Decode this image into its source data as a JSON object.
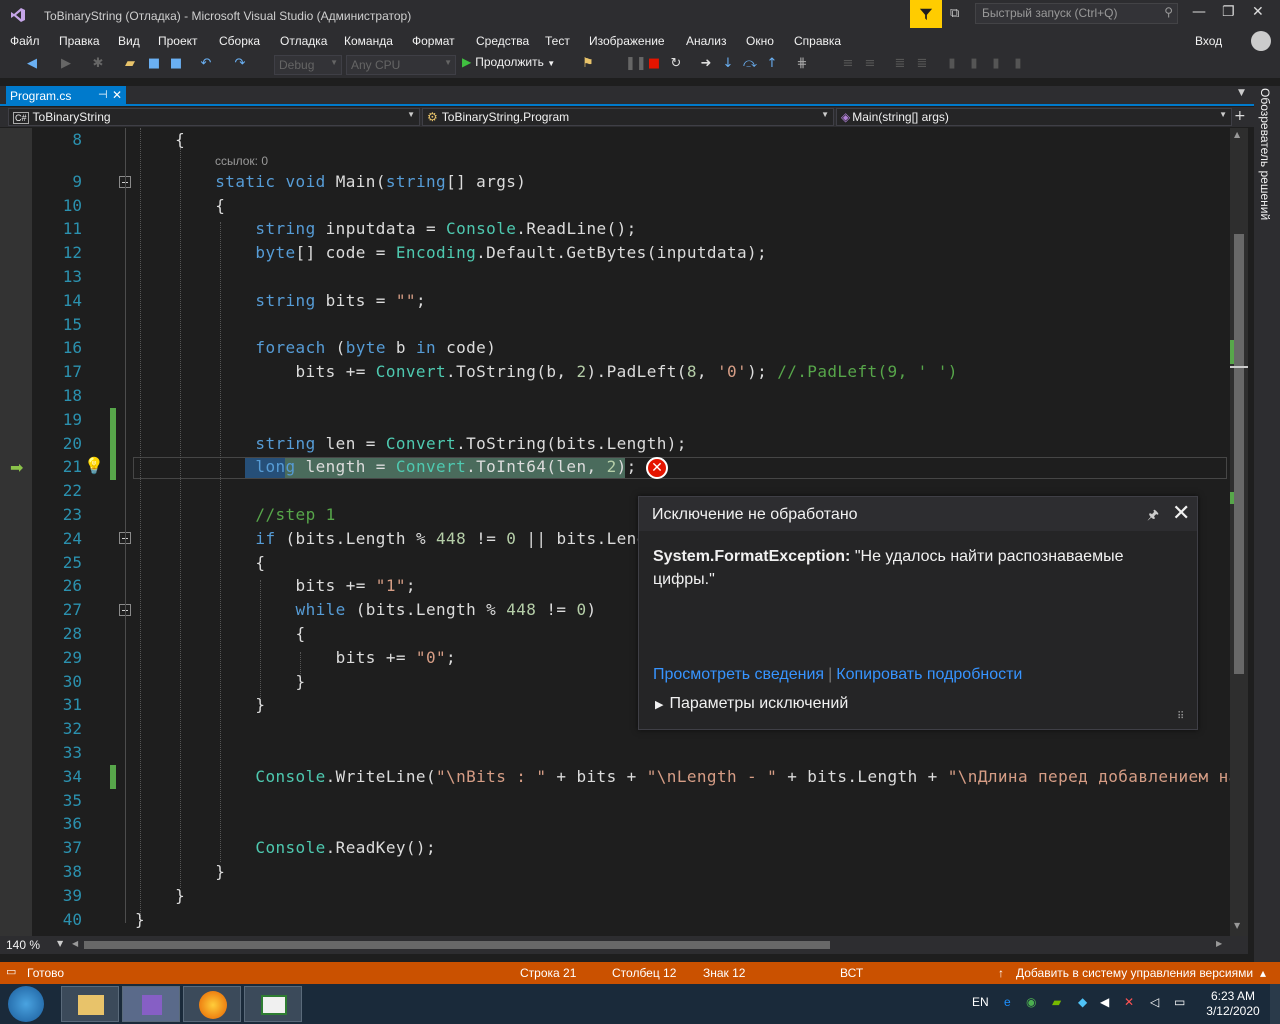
{
  "window": {
    "title": "ToBinaryString (Отладка) - Microsoft Visual Studio  (Администратор)"
  },
  "quick_launch": {
    "placeholder": "Быстрый запуск (Ctrl+Q)"
  },
  "menu": [
    "Файл",
    "Правка",
    "Вид",
    "Проект",
    "Сборка",
    "Отладка",
    "Команда",
    "Формат",
    "Средства",
    "Тест",
    "Изображение",
    "Анализ",
    "Окно",
    "Справка"
  ],
  "account": {
    "signin": "Вход"
  },
  "toolbar": {
    "config": "Debug",
    "platform": "Any CPU",
    "continue": "Продолжить"
  },
  "tab": {
    "label": "Program.cs"
  },
  "nav": {
    "project": "ToBinaryString",
    "class": "ToBinaryString.Program",
    "member": "Main(string[] args)"
  },
  "side_panel": {
    "label": "Обозреватель решений"
  },
  "editor": {
    "line_numbers": [
      "8",
      "9",
      "10",
      "11",
      "12",
      "13",
      "14",
      "15",
      "16",
      "17",
      "18",
      "19",
      "20",
      "21",
      "22",
      "23",
      "24",
      "25",
      "26",
      "27",
      "28",
      "29",
      "30",
      "31",
      "32",
      "33",
      "34",
      "35",
      "36",
      "37",
      "38",
      "39",
      "40"
    ],
    "refs": "ссылок: 0"
  },
  "exception": {
    "title": "Исключение не обработано",
    "type": "System.FormatException:",
    "message": "\"Не удалось найти распознаваемые цифры.\"",
    "link_details": "Просмотреть сведения",
    "link_copy": "Копировать подробности",
    "settings": "Параметры исключений"
  },
  "zoom": "140 %",
  "status": {
    "ready": "Готово",
    "line": "Строка 21",
    "col": "Столбец 12",
    "char": "Знак 12",
    "mode": "ВСТ",
    "vcs": "Добавить в систему управления версиями"
  },
  "taskbar": {
    "lang": "EN",
    "time": "6:23 AM",
    "date": "3/12/2020"
  },
  "colors": {
    "accent": "#007acc",
    "status": "#ca5100",
    "error": "#e51400"
  }
}
